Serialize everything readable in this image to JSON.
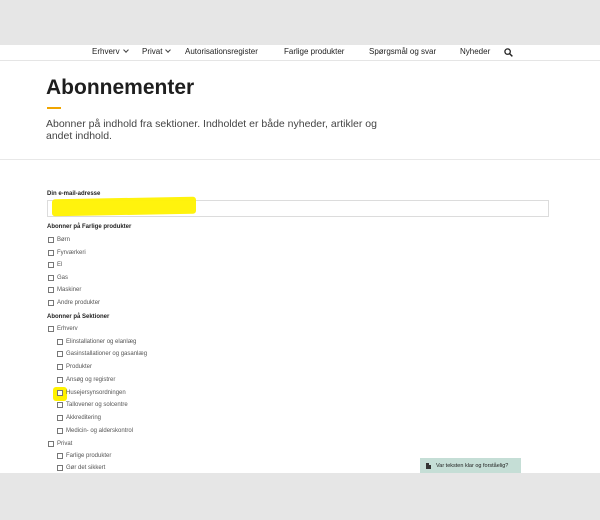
{
  "nav": {
    "items": [
      {
        "label": "Erhverv",
        "has_dropdown": true
      },
      {
        "label": "Privat",
        "has_dropdown": true
      },
      {
        "label": "Autorisationsregister",
        "has_dropdown": false
      },
      {
        "label": "Farlige produkter",
        "has_dropdown": false
      },
      {
        "label": "Spørgsmål og svar",
        "has_dropdown": false
      },
      {
        "label": "Nyheder",
        "has_dropdown": false
      }
    ],
    "search_icon": "search-icon"
  },
  "header": {
    "title": "Abonnementer",
    "subtitle": "Abonner på indhold fra sektioner. Indholdet er både nyheder, artikler og andet indhold.",
    "accent_color": "#f0a500"
  },
  "form": {
    "email_label": "Din e-mail-adresse",
    "email_value": "",
    "farlige_label": "Abonner på Farlige produkter",
    "farlige_options": [
      "Børn",
      "Fyrværkeri",
      "El",
      "Gas",
      "Maskiner",
      "Andre produkter"
    ],
    "sektioner_label": "Abonner på Sektioner",
    "sektioner": {
      "erhverv": "Erhverv",
      "erhverv_children": [
        "Elinstallationer og elanlæg",
        "Gasinstallationer og gasanlæg",
        "Produkter",
        "Ansøg og registrer",
        "Husejersynsordningen",
        "Tallovener og solcentre",
        "Akkreditering",
        "Medicin- og alderskontrol"
      ],
      "privat": "Privat",
      "privat_children": [
        "Farlige produkter",
        "Gør det sikkert"
      ]
    }
  },
  "feedback": {
    "label": "Var teksten klar og forståelig?"
  },
  "colors": {
    "highlight": "#fff200",
    "feedback_bg": "#c5ded6"
  }
}
